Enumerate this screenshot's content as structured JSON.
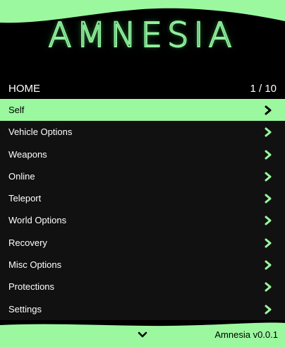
{
  "header": {
    "logo_text": "AMNESIA"
  },
  "titlebar": {
    "title": "HOME",
    "counter": "1 / 10"
  },
  "menu": {
    "items": [
      {
        "label": "Self",
        "selected": true
      },
      {
        "label": "Vehicle Options",
        "selected": false
      },
      {
        "label": "Weapons",
        "selected": false
      },
      {
        "label": "Online",
        "selected": false
      },
      {
        "label": "Teleport",
        "selected": false
      },
      {
        "label": "World Options",
        "selected": false
      },
      {
        "label": "Recovery",
        "selected": false
      },
      {
        "label": "Misc Options",
        "selected": false
      },
      {
        "label": "Protections",
        "selected": false
      },
      {
        "label": "Settings",
        "selected": false
      }
    ],
    "item_icon": "chevron-right-icon"
  },
  "footer": {
    "scroll_icon": "chevron-down-icon",
    "version": "Amnesia v0.0.1"
  },
  "colors": {
    "accent": "#9bf89f",
    "background": "#000000",
    "list_background": "#111111",
    "text": "#ffffff"
  }
}
